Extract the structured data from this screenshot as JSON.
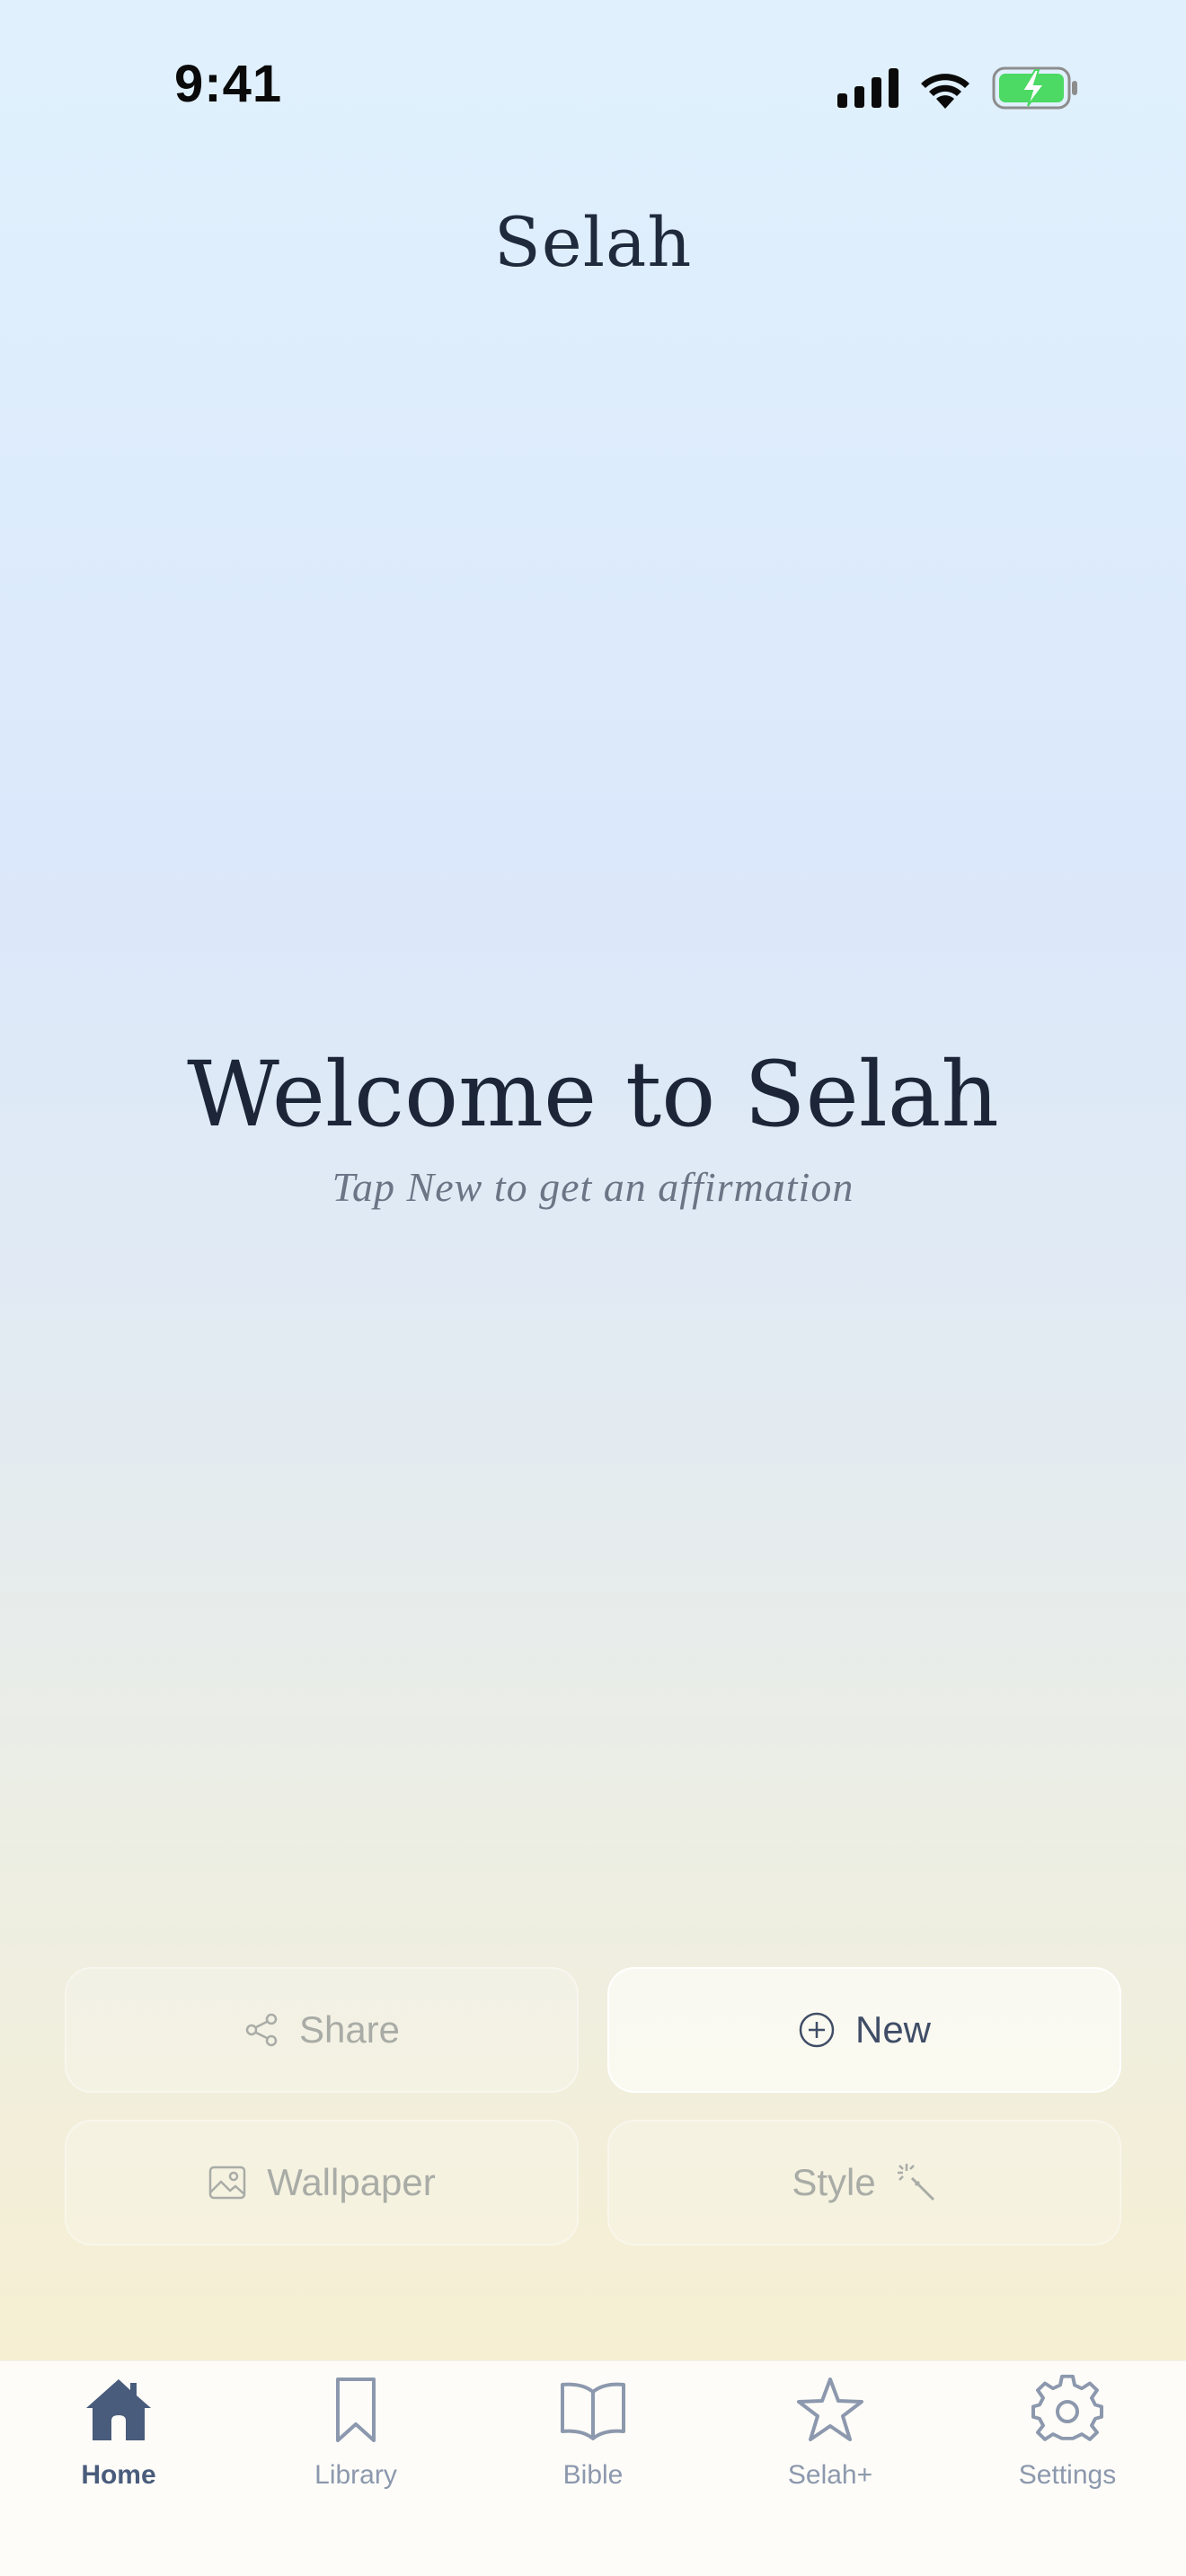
{
  "status_bar": {
    "time": "9:41"
  },
  "header": {
    "title": "Selah"
  },
  "welcome": {
    "title": "Welcome to Selah",
    "subtitle": "Tap New to get an affirmation"
  },
  "actions": {
    "share_label": "Share",
    "new_label": "New",
    "wallpaper_label": "Wallpaper",
    "style_label": "Style"
  },
  "tab_bar": {
    "active": "Home",
    "items": [
      {
        "label": "Home",
        "icon": "house-icon"
      },
      {
        "label": "Library",
        "icon": "bookmark-icon"
      },
      {
        "label": "Bible",
        "icon": "open-book-icon"
      },
      {
        "label": "Selah+",
        "icon": "star-icon"
      },
      {
        "label": "Settings",
        "icon": "gear-icon"
      }
    ]
  },
  "colors": {
    "accent": "#4a5c7c",
    "inactive": "#8c98ad",
    "title_text": "#1c2638",
    "battery_green": "#4cd964"
  }
}
